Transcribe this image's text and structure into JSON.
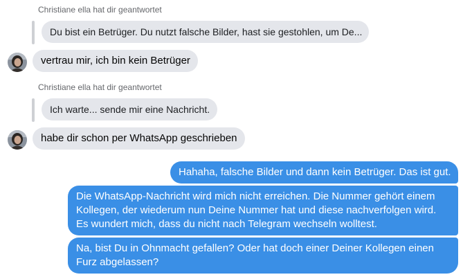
{
  "messages": [
    {
      "reply_caption": "Christiane ella hat dir geantwortet",
      "quoted": "Du bist ein Betrüger. Du nutzt falsche Bilder, hast sie gestohlen, um De...",
      "text": "vertrau mir, ich bin kein Betrüger"
    },
    {
      "reply_caption": "Christiane ella hat dir geantwortet",
      "quoted": "Ich warte... sende mir eine Nachricht.",
      "text": "habe dir schon per WhatsApp geschrieben"
    }
  ],
  "outgoing": [
    {
      "lines": [
        "Hahaha, falsche Bilder und dann kein Betrüger. Das ist gut."
      ]
    },
    {
      "lines": [
        "Die WhatsApp-Nachricht wird mich nicht erreichen. Die Nummer gehört einem",
        "Kollegen, der wiederum nun Deine Nummer hat und diese nachverfolgen wird.",
        "Es wundert mich, dass du nicht nach Telegram wechseln wolltest."
      ]
    },
    {
      "lines": [
        "Na, bist Du in Ohnmacht gefallen? Oder hat doch einer Deiner Kollegen einen",
        "Furz abgelassen?"
      ]
    }
  ],
  "colors": {
    "incoming_bubble": "#e4e6eb",
    "outgoing_bubble": "#3a8fe6",
    "caption_text": "#65676b"
  },
  "icons": {
    "avatar": "contact-avatar"
  }
}
